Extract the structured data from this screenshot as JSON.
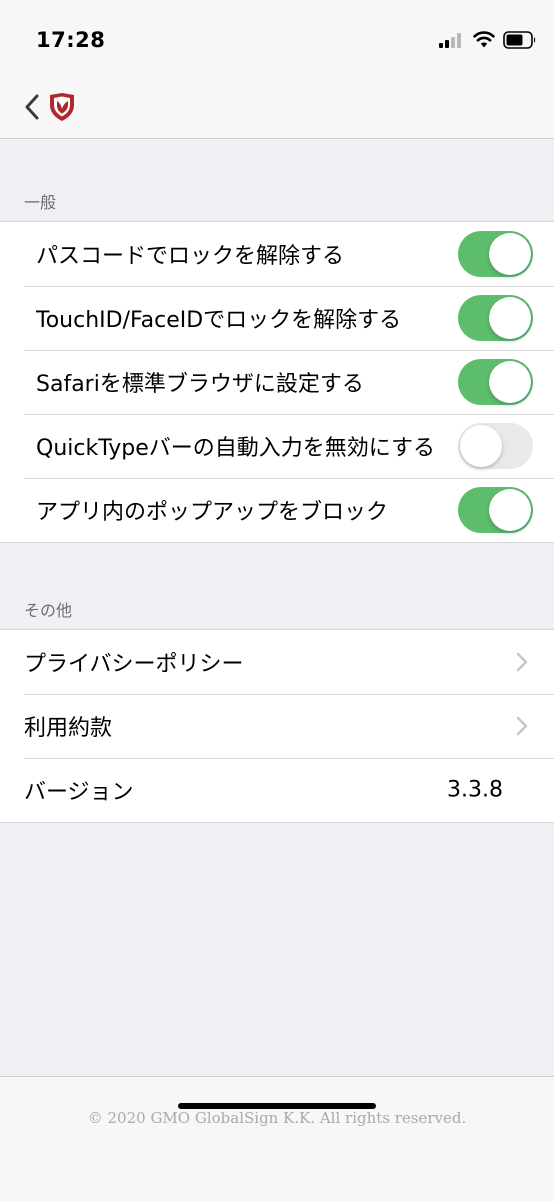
{
  "status_bar": {
    "time": "17:28",
    "signal_icon": "cellular-signal-icon",
    "wifi_icon": "wifi-icon",
    "battery_icon": "battery-icon"
  },
  "nav": {
    "back_icon": "chevron-left-icon",
    "logo_icon": "shield-logo-icon",
    "accent_color": "#b1272d"
  },
  "sections": {
    "general": {
      "header": "一般",
      "rows": [
        {
          "label": "パスコードでロックを解除する",
          "toggle_on": true
        },
        {
          "label": "TouchID/FaceIDでロックを解除する",
          "toggle_on": true
        },
        {
          "label": "Safariを標準ブラウザに設定する",
          "toggle_on": true
        },
        {
          "label": "QuickTypeバーの自動入力を無効にする",
          "toggle_on": false
        },
        {
          "label": "アプリ内のポップアップをブロック",
          "toggle_on": true
        }
      ]
    },
    "other": {
      "header": "その他",
      "rows": [
        {
          "label": "プライバシーポリシー",
          "accessory": "chevron-right-icon"
        },
        {
          "label": "利用約款",
          "accessory": "chevron-right-icon"
        },
        {
          "label": "バージョン",
          "value": "3.3.8"
        }
      ]
    }
  },
  "footer": {
    "copyright": "© 2020 GMO GlobalSign K.K. All rights reserved."
  },
  "colors": {
    "toggle_on": "#5cbd6c",
    "toggle_off": "#e9e9ea",
    "background": "#efeff4"
  }
}
